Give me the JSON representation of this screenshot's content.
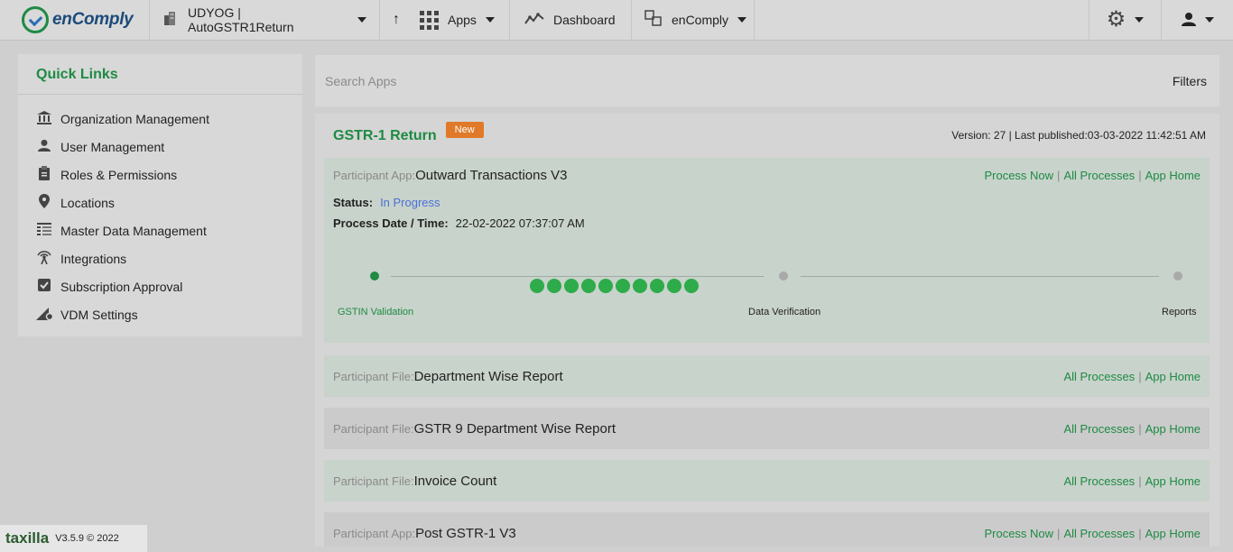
{
  "topbar": {
    "brand": "enComply",
    "org": "UDYOG | AutoGSTR1Return",
    "up_arrow": "↑",
    "apps": "Apps",
    "dashboard": "Dashboard",
    "product": "enComply",
    "icons": [
      "building-icon",
      "grid-icon",
      "chart-icon",
      "switch-icon",
      "gear-icon",
      "user-icon"
    ]
  },
  "sidebar": {
    "title": "Quick Links",
    "items": [
      {
        "label": "Organization Management",
        "icon": "bank-icon"
      },
      {
        "label": "User Management",
        "icon": "user-icon"
      },
      {
        "label": "Roles & Permissions",
        "icon": "clipboard-icon"
      },
      {
        "label": "Locations",
        "icon": "map-pin-icon"
      },
      {
        "label": "Master Data Management",
        "icon": "table-icon"
      },
      {
        "label": "Integrations",
        "icon": "antenna-icon"
      },
      {
        "label": "Subscription Approval",
        "icon": "check-square-icon"
      },
      {
        "label": "VDM Settings",
        "icon": "settings-triangle-icon"
      }
    ]
  },
  "search": {
    "placeholder": "Search Apps",
    "filters": "Filters"
  },
  "card": {
    "title": "GSTR-1 Return",
    "badge": "New",
    "version": "Version: 27 | Last published:03-03-2022 11:42:51 AM",
    "first": {
      "label": "Participant App:",
      "name": "Outward Transactions V3",
      "process_now": "Process Now",
      "all_processes": "All Processes",
      "app_home": "App Home",
      "status_label": "Status:",
      "status_value": "In Progress",
      "date_label": "Process Date / Time:",
      "date_value": "22-02-2022 07:37:07 AM",
      "steps": [
        "GSTIN Validation",
        "Data Verification",
        "Reports"
      ]
    },
    "rows": [
      {
        "label": "Participant File:",
        "name": "Department Wise Report",
        "all_processes": "All Processes",
        "app_home": "App Home"
      },
      {
        "label": "Participant File:",
        "name": "GSTR 9 Department Wise Report",
        "all_processes": "All Processes",
        "app_home": "App Home"
      },
      {
        "label": "Participant File:",
        "name": "Invoice Count",
        "all_processes": "All Processes",
        "app_home": "App Home"
      },
      {
        "label": "Participant App:",
        "name": "Post GSTR-1 V3",
        "process_now": "Process Now",
        "all_processes": "All Processes",
        "app_home": "App Home"
      }
    ]
  },
  "footer": {
    "brand": "taxilla",
    "version": "V3.5.9 © 2022"
  },
  "colors": {
    "accent": "#1e8a44",
    "badge": "#e07a2a",
    "status": "#4a6fd8"
  }
}
